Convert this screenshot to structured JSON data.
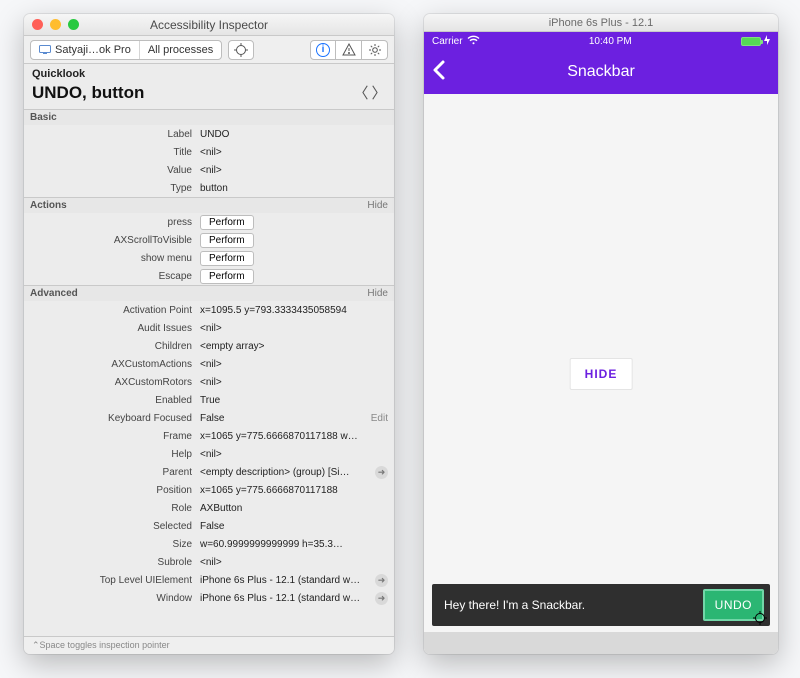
{
  "inspector": {
    "window_title": "Accessibility Inspector",
    "crumbs": {
      "host": "Satyaji…ok Pro",
      "target": "All processes"
    },
    "quicklook_label": "Quicklook",
    "headline": "UNDO, button",
    "sections": {
      "basic": {
        "title": "Basic",
        "rows": {
          "label": {
            "k": "Label",
            "v": "UNDO"
          },
          "title": {
            "k": "Title",
            "v": "<nil>",
            "nil": true
          },
          "value": {
            "k": "Value",
            "v": "<nil>",
            "nil": true
          },
          "type": {
            "k": "Type",
            "v": "button"
          }
        }
      },
      "actions": {
        "title": "Actions",
        "hide": "Hide",
        "perform": "Perform",
        "rows": {
          "press": "press",
          "scroll": "AXScrollToVisible",
          "menu": "show menu",
          "escape": "Escape"
        }
      },
      "advanced": {
        "title": "Advanced",
        "hide": "Hide",
        "edit": "Edit",
        "rows": {
          "activation": {
            "k": "Activation Point",
            "v": "x=1095.5 y=793.333343505859​4"
          },
          "audit": {
            "k": "Audit Issues",
            "v": "<nil>",
            "nil": true
          },
          "children": {
            "k": "Children",
            "v": "<empty array>",
            "nil": true
          },
          "custactions": {
            "k": "AXCustomActions",
            "v": "<nil>",
            "nil": true
          },
          "custrotors": {
            "k": "AXCustomRotors",
            "v": "<nil>",
            "nil": true
          },
          "enabled": {
            "k": "Enabled",
            "v": "True"
          },
          "keyfocus": {
            "k": "Keyboard Focused",
            "v": "False"
          },
          "frame": {
            "k": "Frame",
            "v": "x=1065 y=775.666687011718​8 w…"
          },
          "help": {
            "k": "Help",
            "v": "<nil>",
            "nil": true
          },
          "parent": {
            "k": "Parent",
            "v": "<empty description> (group) [Si…",
            "go": true
          },
          "position": {
            "k": "Position",
            "v": "x=1065 y=775.666687011718​8"
          },
          "role": {
            "k": "Role",
            "v": "AXButton"
          },
          "selected": {
            "k": "Selected",
            "v": "False"
          },
          "size": {
            "k": "Size",
            "v": "w=60.999999999999​9 h=35.3…"
          },
          "subrole": {
            "k": "Subrole",
            "v": "<nil>",
            "nil": true
          },
          "toplevel": {
            "k": "Top Level UIElement",
            "v": "iPhone 6s Plus - 12.1 (standard w…",
            "go": true
          },
          "window": {
            "k": "Window",
            "v": "iPhone 6s Plus - 12.1 (standard w…",
            "go": true
          }
        }
      }
    },
    "footer": "⌃Space toggles inspection pointer"
  },
  "sim": {
    "window_title": "iPhone 6s Plus - 12.1",
    "carrier": "Carrier",
    "time": "10:40 PM",
    "nav_title": "Snackbar",
    "hide_label": "HIDE",
    "snackbar_text": "Hey there! I'm a Snackbar.",
    "undo_label": "UNDO"
  }
}
